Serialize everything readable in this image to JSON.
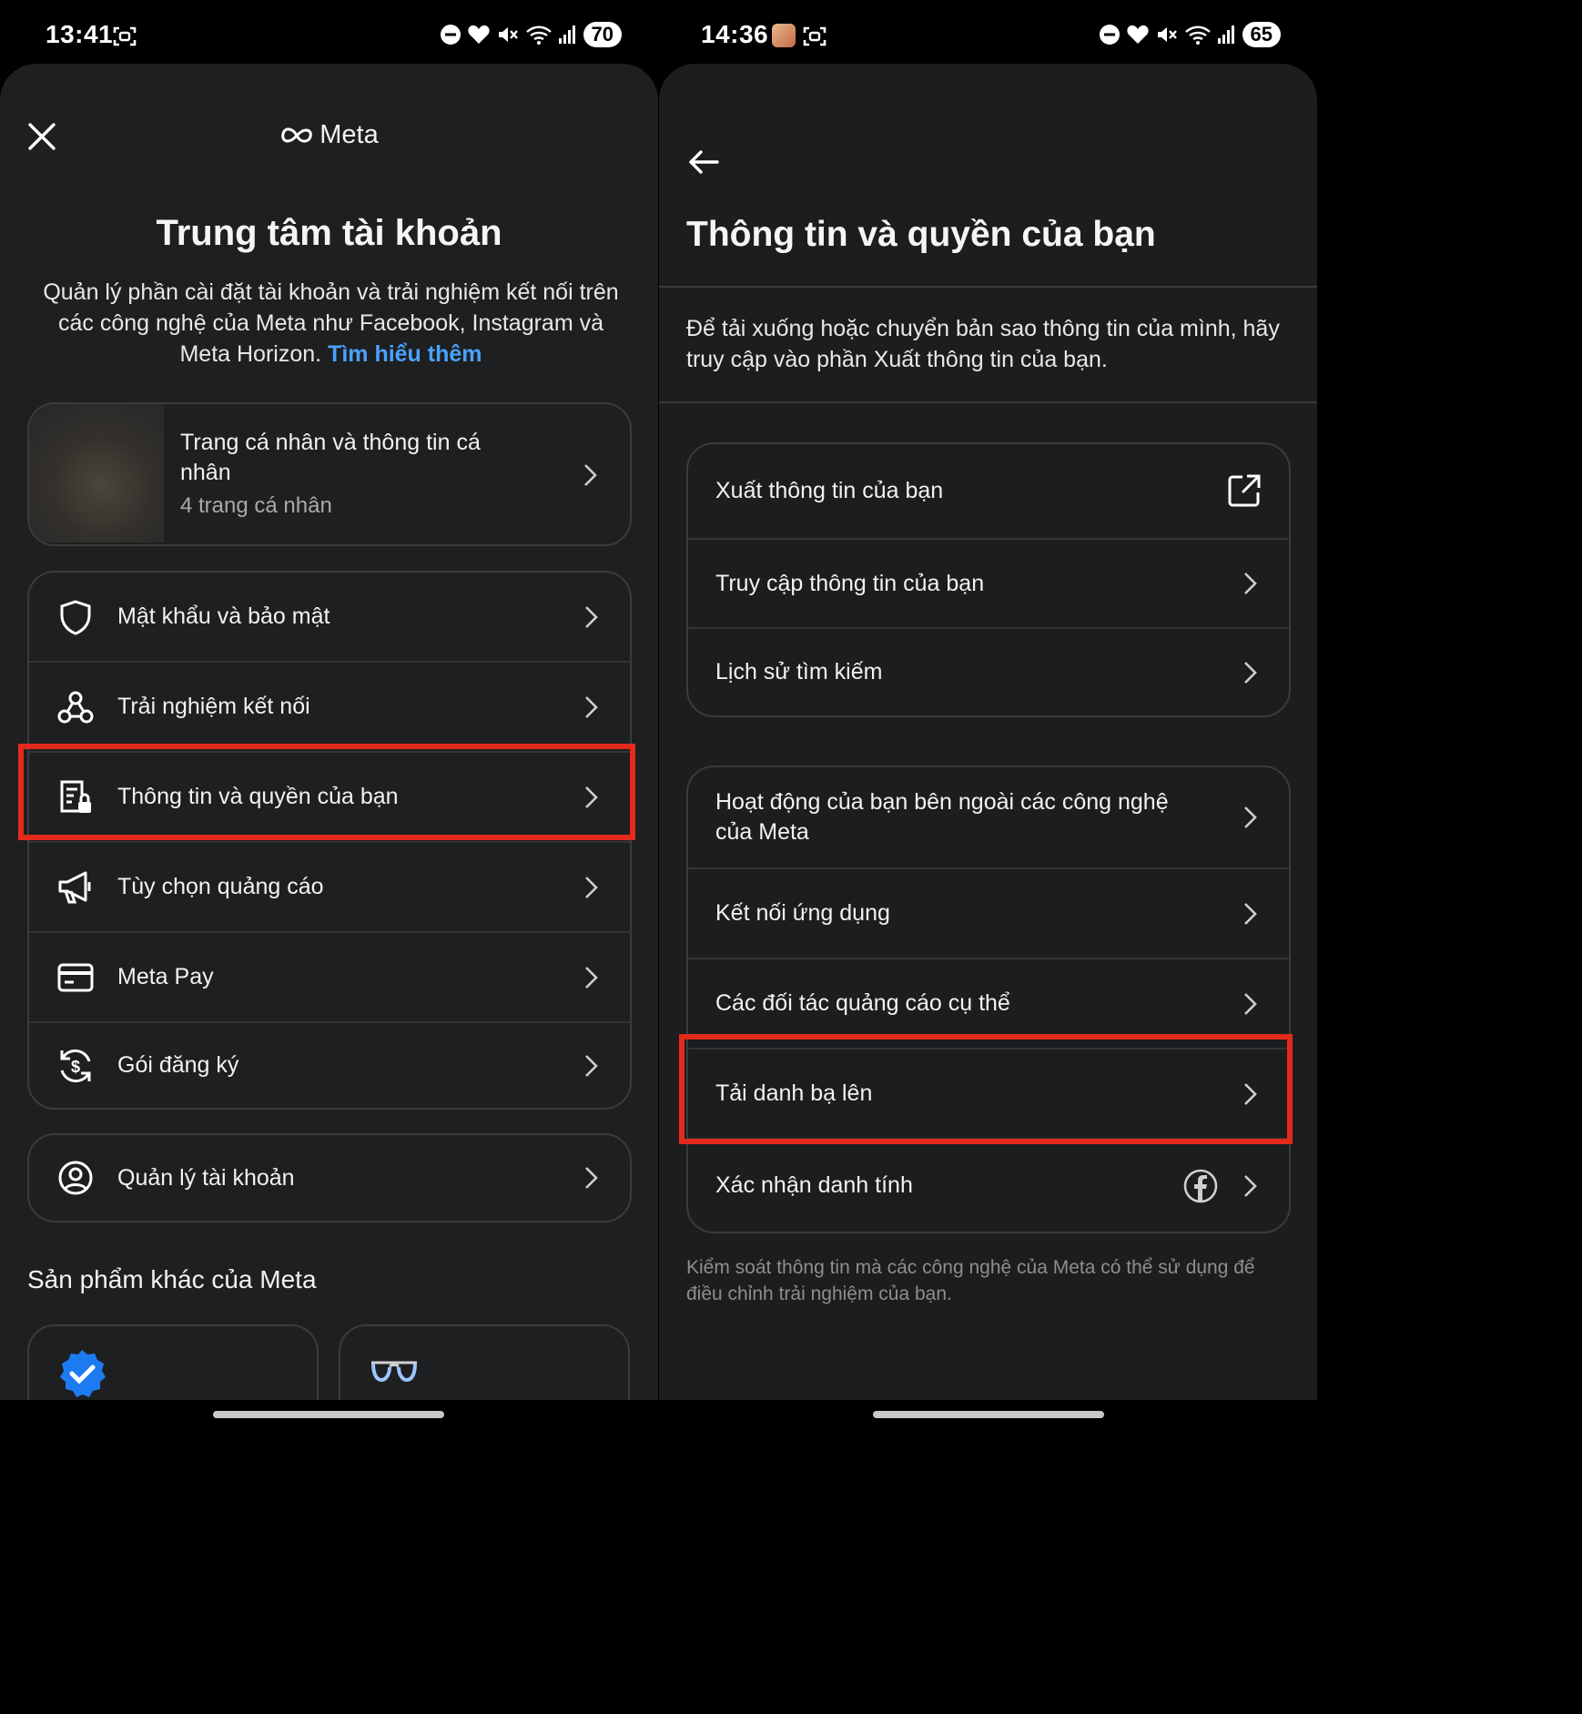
{
  "left": {
    "status": {
      "time": "13:41",
      "battery": "70"
    },
    "header": {
      "logo_text": "Meta"
    },
    "title": "Trung tâm tài khoản",
    "description": "Quản lý phần cài đặt tài khoản và trải nghiệm kết nối trên các công nghệ của Meta như Facebook, Instagram và Meta Horizon.",
    "learn_more": "Tìm hiểu thêm",
    "profile_card": {
      "title": "Trang cá nhân và thông tin cá nhân",
      "subtitle": "4 trang cá nhân"
    },
    "menu": [
      {
        "label": "Mật khẩu và bảo mật",
        "icon": "shield-icon"
      },
      {
        "label": "Trải nghiệm kết nối",
        "icon": "connected-nodes-icon"
      },
      {
        "label": "Thông tin và quyền của bạn",
        "icon": "info-lock-icon"
      },
      {
        "label": "Tùy chọn quảng cáo",
        "icon": "megaphone-icon"
      },
      {
        "label": "Meta Pay",
        "icon": "card-icon"
      },
      {
        "label": "Gói đăng ký",
        "icon": "subscription-icon"
      }
    ],
    "account_management": {
      "label": "Quản lý tài khoản",
      "icon": "user-circle-icon"
    },
    "other_products_title": "Sản phẩm khác của Meta",
    "highlight_color": "#e42a1b",
    "link_color": "#4aa3ff"
  },
  "right": {
    "status": {
      "time": "14:36",
      "battery": "65"
    },
    "title": "Thông tin và quyền của bạn",
    "description": "Để tải xuống hoặc chuyển bản sao thông tin của mình, hãy truy cập vào phần Xuất thông tin của bạn.",
    "group1": [
      {
        "label": "Xuất thông tin của bạn",
        "icon": "external-link-icon"
      },
      {
        "label": "Truy cập thông tin của bạn"
      },
      {
        "label": "Lịch sử tìm kiếm"
      }
    ],
    "group2": [
      {
        "label": "Hoạt động của bạn bên ngoài các công nghệ của Meta"
      },
      {
        "label": "Kết nối ứng dụng"
      },
      {
        "label": "Các đối tác quảng cáo cụ thể"
      },
      {
        "label": "Tải danh bạ lên"
      },
      {
        "label": "Xác nhận danh tính",
        "icon": "facebook-icon"
      }
    ],
    "footer_note": "Kiểm soát thông tin mà các công nghệ của Meta có thể sử dụng để điều chỉnh trải nghiệm của bạn."
  }
}
